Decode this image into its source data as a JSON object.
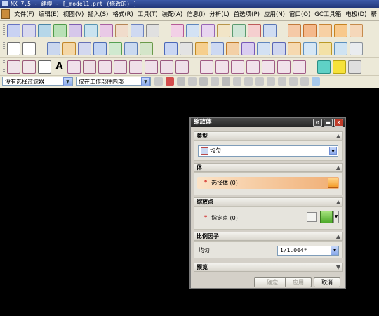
{
  "window": {
    "title": "NX 7.5 - 建模 - [_model1.prt  (修改的) ]"
  },
  "menu": [
    "文件(F)",
    "编辑(E)",
    "视图(V)",
    "插入(S)",
    "格式(R)",
    "工具(T)",
    "装配(A)",
    "信息(I)",
    "分析(L)",
    "首选项(P)",
    "应用(N)",
    "窗口(O)",
    "GC工具箱",
    "电极(D)",
    "帮"
  ],
  "filters": {
    "type_filter": "没有选择过滤器",
    "scope_filter": "仅在工作部件内部"
  },
  "dialog": {
    "title": "缩放体",
    "sections": {
      "type": {
        "header": "类型",
        "value": "均匀"
      },
      "body": {
        "header": "体",
        "select_label": "选择体 (0)"
      },
      "scale_point": {
        "header": "缩放点",
        "specify_label": "指定点 (0)"
      },
      "scale_factor": {
        "header": "比例因子",
        "uniform_label": "均匀",
        "uniform_value": "1/1.004*"
      },
      "preview": {
        "header": "预览"
      }
    },
    "buttons": {
      "ok": "确定",
      "apply": "应用",
      "cancel": "取消"
    }
  },
  "colors": {
    "title_gradient": "#22377a",
    "viewport": "#000000",
    "dialog_bg": "#d4d0c8",
    "selection_highlight": "#f0ae74",
    "required_asterisk": "#d01818"
  }
}
